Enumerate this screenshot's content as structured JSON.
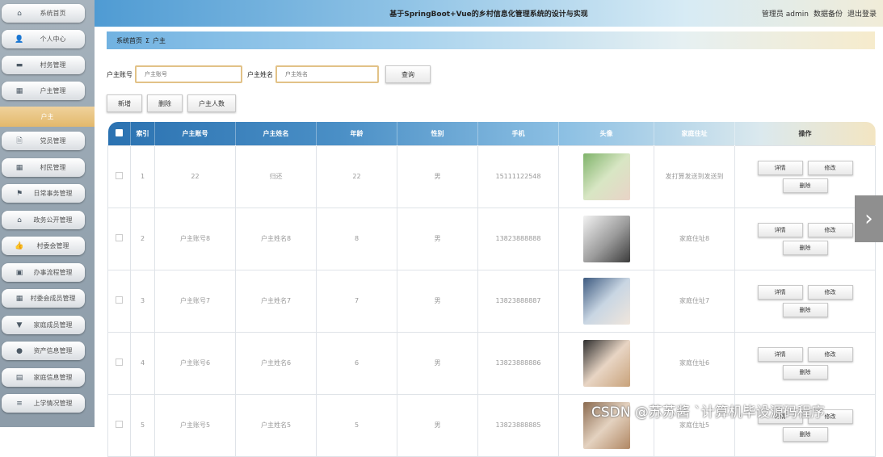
{
  "header": {
    "title": "基于SpringBoot+Vue的乡村信息化管理系统的设计与实现",
    "role_label": "管理员 admin",
    "backup_label": "数据备份",
    "logout_label": "退出登录"
  },
  "sidebar": {
    "items": [
      {
        "icon": "⌂",
        "label": "系统首页"
      },
      {
        "icon": "👤",
        "label": "个人中心"
      },
      {
        "icon": "▬",
        "label": "村务管理"
      },
      {
        "icon": "▦",
        "label": "户主管理"
      },
      {
        "icon": "🗎",
        "label": "党员管理"
      },
      {
        "icon": "▦",
        "label": "村民管理"
      },
      {
        "icon": "⚑",
        "label": "日常事务管理"
      },
      {
        "icon": "⌂",
        "label": "政务公开管理"
      },
      {
        "icon": "👍",
        "label": "村委会管理"
      },
      {
        "icon": "▣",
        "label": "办事流程管理"
      },
      {
        "icon": "▦",
        "label": "村委会成员管理"
      },
      {
        "icon": "▼",
        "label": "家庭成员管理"
      },
      {
        "icon": "●",
        "label": "资产信息管理"
      },
      {
        "icon": "▤",
        "label": "家庭信息管理"
      },
      {
        "icon": "≡",
        "label": "上学情况管理"
      }
    ],
    "active_label": "户主"
  },
  "breadcrumb": {
    "home": "系统首页",
    "sep": "Σ",
    "current": "户主"
  },
  "search": {
    "account_label": "户主账号",
    "account_placeholder": "户主账号",
    "name_label": "户主姓名",
    "name_placeholder": "户主姓名",
    "query_label": "查询"
  },
  "actions": {
    "add_label": "新增",
    "delete_label": "删除",
    "count_label": "户主人数"
  },
  "table": {
    "columns": [
      "索引",
      "户主账号",
      "户主姓名",
      "年龄",
      "性别",
      "手机",
      "头像",
      "家庭住址",
      "操作"
    ],
    "rows": [
      {
        "index": "1",
        "account": "22",
        "name": "归还",
        "age": "22",
        "gender": "男",
        "phone": "15111122548",
        "address": "发打算发送到发送到"
      },
      {
        "index": "2",
        "account": "户主账号8",
        "name": "户主姓名8",
        "age": "8",
        "gender": "男",
        "phone": "13823888888",
        "address": "家庭住址8"
      },
      {
        "index": "3",
        "account": "户主账号7",
        "name": "户主姓名7",
        "age": "7",
        "gender": "男",
        "phone": "13823888887",
        "address": "家庭住址7"
      },
      {
        "index": "4",
        "account": "户主账号6",
        "name": "户主姓名6",
        "age": "6",
        "gender": "男",
        "phone": "13823888886",
        "address": "家庭住址6"
      },
      {
        "index": "5",
        "account": "户主账号5",
        "name": "户主姓名5",
        "age": "5",
        "gender": "男",
        "phone": "13823888885",
        "address": "家庭住址5"
      }
    ],
    "op_detail": "详情",
    "op_edit": "修改",
    "op_delete": "删除"
  },
  "watermark": "CSDN @苏苏酱   `计算机毕设源码程序"
}
